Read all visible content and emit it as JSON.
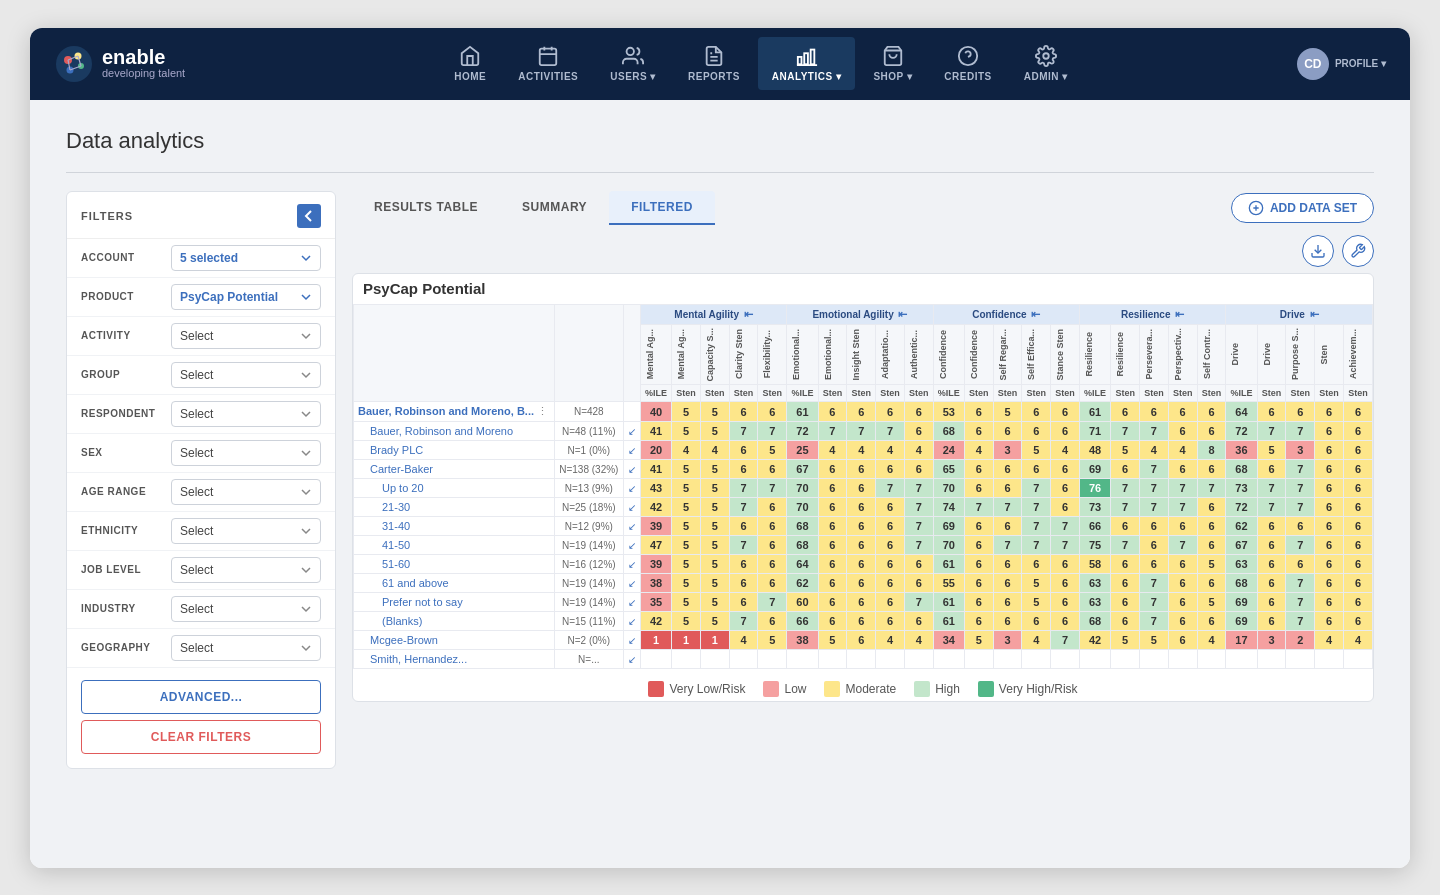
{
  "app": {
    "logo_name": "enable",
    "logo_sub": "developing talent",
    "profile_initials": "CD"
  },
  "nav": {
    "items": [
      {
        "id": "home",
        "label": "HOME",
        "icon": "home"
      },
      {
        "id": "activities",
        "label": "ACTIVITIES",
        "icon": "activities"
      },
      {
        "id": "users",
        "label": "USERS",
        "icon": "users",
        "has_dropdown": true
      },
      {
        "id": "reports",
        "label": "REPORTS",
        "icon": "reports"
      },
      {
        "id": "analytics",
        "label": "ANALYTICS",
        "icon": "analytics",
        "has_dropdown": true,
        "active": true
      },
      {
        "id": "shop",
        "label": "SHOP",
        "icon": "shop",
        "has_dropdown": true
      },
      {
        "id": "credits",
        "label": "CREDITS",
        "icon": "credits"
      },
      {
        "id": "admin",
        "label": "ADMIN",
        "icon": "admin",
        "has_dropdown": true
      },
      {
        "id": "profile",
        "label": "PROFILE",
        "icon": "profile",
        "has_dropdown": true
      }
    ]
  },
  "page": {
    "title": "Data analytics"
  },
  "filters": {
    "title": "FILTERS",
    "rows": [
      {
        "label": "ACCOUNT",
        "value": "5 selected",
        "is_selected": true
      },
      {
        "label": "PRODUCT",
        "value": "PsyCap Potential",
        "is_selected": true
      },
      {
        "label": "ACTIVITY",
        "value": "Select"
      },
      {
        "label": "GROUP",
        "value": "Select"
      },
      {
        "label": "RESPONDENT",
        "value": "Select"
      },
      {
        "label": "SEX",
        "value": "Select"
      },
      {
        "label": "AGE RANGE",
        "value": "Select"
      },
      {
        "label": "ETHNICITY",
        "value": "Select"
      },
      {
        "label": "JOB LEVEL",
        "value": "Select"
      },
      {
        "label": "INDUSTRY",
        "value": "Select"
      },
      {
        "label": "GEOGRAPHY",
        "value": "Select"
      }
    ],
    "advanced_label": "ADVANCED...",
    "clear_label": "CLEAR FILTERS"
  },
  "tabs": [
    {
      "id": "results",
      "label": "RESULTS TABLE"
    },
    {
      "id": "summary",
      "label": "SUMMARY"
    },
    {
      "id": "filtered",
      "label": "FILTERED",
      "active": true
    }
  ],
  "add_dataset": "ADD DATA SET",
  "table": {
    "product": "PsyCap Potential",
    "column_groups": [
      {
        "label": "Mental Agility",
        "cols": [
          "Mental Ag...",
          "Mental Ag...",
          "Capacity S...",
          "Clarity Sten",
          "Flexibility..."
        ]
      },
      {
        "label": "Emotional Agility",
        "cols": [
          "Emotional...",
          "Emotional...",
          "Insight Sten",
          "Adaptatio...",
          "Authentic..."
        ]
      },
      {
        "label": "Confidence",
        "cols": [
          "Confidence",
          "Confidence",
          "Self Regar...",
          "Self Effica...",
          "Stance Sten"
        ]
      },
      {
        "label": "Resilience",
        "cols": [
          "Resilience",
          "Resilience",
          "Persevera...",
          "Perspectiv...",
          "Self Contr..."
        ]
      },
      {
        "label": "Drive",
        "cols": [
          "Drive",
          "Drive",
          "Purpose S...",
          "Sten",
          "Achievem..."
        ]
      }
    ],
    "rows": [
      {
        "name": "Bauer, Robinson and Moreno, B...",
        "indent": 0,
        "n": "N=428",
        "pct": "",
        "dir": "",
        "vals": [
          40,
          5,
          5,
          6,
          6,
          61,
          6,
          6,
          6,
          6,
          53,
          6,
          5,
          6,
          6,
          61,
          6,
          6,
          6,
          6,
          64,
          6,
          6,
          6,
          6
        ]
      },
      {
        "name": "Bauer, Robinson and Moreno",
        "indent": 1,
        "n": "N=48 (11%)",
        "dir": "↙",
        "vals": [
          41,
          5,
          5,
          7,
          7,
          72,
          7,
          7,
          7,
          6,
          68,
          6,
          6,
          6,
          6,
          71,
          7,
          7,
          6,
          6,
          72,
          7,
          7,
          6,
          6
        ]
      },
      {
        "name": "Brady PLC",
        "indent": 1,
        "n": "N=1 (0%)",
        "dir": "↙",
        "vals": [
          20,
          4,
          4,
          6,
          5,
          25,
          4,
          4,
          4,
          4,
          24,
          4,
          3,
          5,
          4,
          48,
          5,
          4,
          4,
          8,
          36,
          5,
          3,
          6,
          6
        ]
      },
      {
        "name": "Carter-Baker",
        "indent": 1,
        "n": "N=138 (32%)",
        "dir": "↙",
        "vals": [
          41,
          5,
          5,
          6,
          6,
          67,
          6,
          6,
          6,
          6,
          65,
          6,
          6,
          6,
          6,
          69,
          6,
          7,
          6,
          6,
          68,
          6,
          7,
          6,
          6
        ]
      },
      {
        "name": "Up to 20",
        "indent": 2,
        "n": "N=13 (9%)",
        "dir": "↙",
        "vals": [
          43,
          5,
          5,
          7,
          7,
          70,
          6,
          6,
          7,
          7,
          70,
          6,
          6,
          7,
          6,
          76,
          7,
          7,
          7,
          7,
          73,
          7,
          7,
          6,
          6
        ]
      },
      {
        "name": "21-30",
        "indent": 2,
        "n": "N=25 (18%)",
        "dir": "↙",
        "vals": [
          42,
          5,
          5,
          7,
          6,
          70,
          6,
          6,
          6,
          7,
          74,
          7,
          7,
          7,
          6,
          73,
          7,
          7,
          7,
          6,
          72,
          7,
          7,
          6,
          6
        ]
      },
      {
        "name": "31-40",
        "indent": 2,
        "n": "N=12 (9%)",
        "dir": "↙",
        "vals": [
          39,
          5,
          5,
          6,
          6,
          68,
          6,
          6,
          6,
          7,
          69,
          6,
          6,
          7,
          7,
          66,
          6,
          6,
          6,
          6,
          62,
          6,
          6,
          6,
          6
        ]
      },
      {
        "name": "41-50",
        "indent": 2,
        "n": "N=19 (14%)",
        "dir": "↙",
        "vals": [
          47,
          5,
          5,
          7,
          6,
          68,
          6,
          6,
          6,
          7,
          70,
          6,
          7,
          7,
          7,
          75,
          7,
          6,
          7,
          6,
          67,
          6,
          7,
          6,
          6
        ]
      },
      {
        "name": "51-60",
        "indent": 2,
        "n": "N=16 (12%)",
        "dir": "↙",
        "vals": [
          39,
          5,
          5,
          6,
          6,
          64,
          6,
          6,
          6,
          6,
          61,
          6,
          6,
          6,
          6,
          58,
          6,
          6,
          6,
          5,
          63,
          6,
          6,
          6,
          6
        ]
      },
      {
        "name": "61 and above",
        "indent": 2,
        "n": "N=19 (14%)",
        "dir": "↙",
        "vals": [
          38,
          5,
          5,
          6,
          6,
          62,
          6,
          6,
          6,
          6,
          55,
          6,
          6,
          5,
          6,
          63,
          6,
          7,
          6,
          6,
          68,
          6,
          7,
          6,
          6
        ]
      },
      {
        "name": "Prefer not to say",
        "indent": 2,
        "n": "N=19 (14%)",
        "dir": "↙",
        "vals": [
          35,
          5,
          5,
          6,
          7,
          60,
          6,
          6,
          6,
          7,
          61,
          6,
          6,
          5,
          6,
          63,
          6,
          7,
          6,
          5,
          69,
          6,
          7,
          6,
          6
        ]
      },
      {
        "name": "(Blanks)",
        "indent": 2,
        "n": "N=15 (11%)",
        "dir": "↙",
        "vals": [
          42,
          5,
          5,
          7,
          6,
          66,
          6,
          6,
          6,
          6,
          61,
          6,
          6,
          6,
          6,
          68,
          6,
          7,
          6,
          6,
          69,
          6,
          7,
          6,
          6
        ]
      },
      {
        "name": "Mcgee-Brown",
        "indent": 1,
        "n": "N=2 (0%)",
        "dir": "↙",
        "vals": [
          1,
          1,
          1,
          4,
          5,
          38,
          5,
          6,
          4,
          4,
          34,
          5,
          3,
          4,
          7,
          42,
          5,
          5,
          6,
          4,
          17,
          3,
          2,
          4,
          4
        ]
      },
      {
        "name": "Smith, Hernandez...",
        "indent": 1,
        "n": "N=...",
        "dir": "↙",
        "vals": []
      }
    ]
  },
  "legend": [
    {
      "label": "Very Low/Risk",
      "color": "#e05a5a"
    },
    {
      "label": "Low",
      "color": "#f5a0a0"
    },
    {
      "label": "Moderate",
      "color": "#fde68a"
    },
    {
      "label": "High",
      "color": "#c3e6cb"
    },
    {
      "label": "Very High/Risk",
      "color": "#52b788"
    }
  ],
  "colors": {
    "nav_bg": "#0e2241",
    "active_nav": "#1a3a60",
    "accent": "#3c6fbd"
  }
}
